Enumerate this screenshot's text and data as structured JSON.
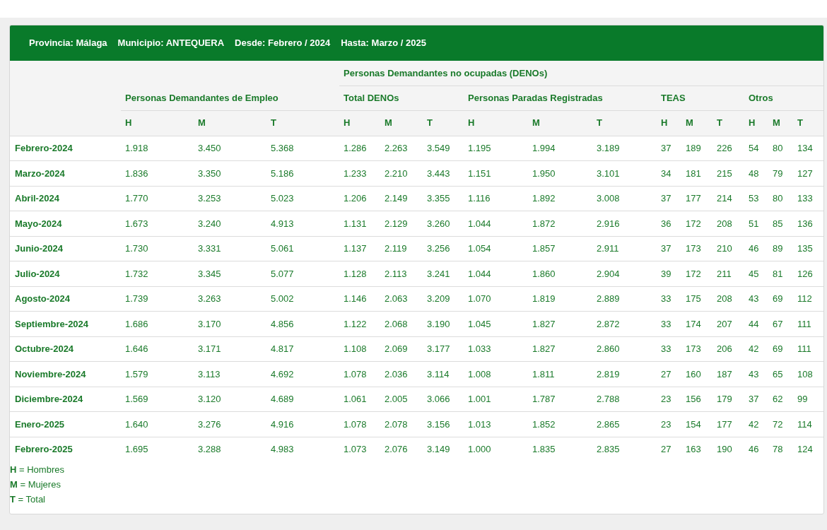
{
  "filter": [
    {
      "label": "Provincia:",
      "value": "Málaga"
    },
    {
      "label": "Municipio:",
      "value": "ANTEQUERA"
    },
    {
      "label": "Desde:",
      "value": "Febrero / 2024"
    },
    {
      "label": "Hasta:",
      "value": "Marzo / 2025"
    }
  ],
  "super_header": "Personas Demandantes no ocupadas (DENOs)",
  "groups": [
    "Personas Demandantes de Empleo",
    "Total DENOs",
    "Personas Paradas Registradas",
    "TEAS",
    "Otros"
  ],
  "subcolumns": [
    "H",
    "M",
    "T",
    "H",
    "M",
    "T",
    "H",
    "M",
    "T",
    "H",
    "M",
    "T",
    "H",
    "M",
    "T"
  ],
  "rows": [
    {
      "month": "Febrero-2024",
      "values": [
        "1.918",
        "3.450",
        "5.368",
        "1.286",
        "2.263",
        "3.549",
        "1.195",
        "1.994",
        "3.189",
        "37",
        "189",
        "226",
        "54",
        "80",
        "134"
      ]
    },
    {
      "month": "Marzo-2024",
      "values": [
        "1.836",
        "3.350",
        "5.186",
        "1.233",
        "2.210",
        "3.443",
        "1.151",
        "1.950",
        "3.101",
        "34",
        "181",
        "215",
        "48",
        "79",
        "127"
      ]
    },
    {
      "month": "Abril-2024",
      "values": [
        "1.770",
        "3.253",
        "5.023",
        "1.206",
        "2.149",
        "3.355",
        "1.116",
        "1.892",
        "3.008",
        "37",
        "177",
        "214",
        "53",
        "80",
        "133"
      ]
    },
    {
      "month": "Mayo-2024",
      "values": [
        "1.673",
        "3.240",
        "4.913",
        "1.131",
        "2.129",
        "3.260",
        "1.044",
        "1.872",
        "2.916",
        "36",
        "172",
        "208",
        "51",
        "85",
        "136"
      ]
    },
    {
      "month": "Junio-2024",
      "values": [
        "1.730",
        "3.331",
        "5.061",
        "1.137",
        "2.119",
        "3.256",
        "1.054",
        "1.857",
        "2.911",
        "37",
        "173",
        "210",
        "46",
        "89",
        "135"
      ]
    },
    {
      "month": "Julio-2024",
      "values": [
        "1.732",
        "3.345",
        "5.077",
        "1.128",
        "2.113",
        "3.241",
        "1.044",
        "1.860",
        "2.904",
        "39",
        "172",
        "211",
        "45",
        "81",
        "126"
      ]
    },
    {
      "month": "Agosto-2024",
      "values": [
        "1.739",
        "3.263",
        "5.002",
        "1.146",
        "2.063",
        "3.209",
        "1.070",
        "1.819",
        "2.889",
        "33",
        "175",
        "208",
        "43",
        "69",
        "112"
      ]
    },
    {
      "month": "Septiembre-2024",
      "values": [
        "1.686",
        "3.170",
        "4.856",
        "1.122",
        "2.068",
        "3.190",
        "1.045",
        "1.827",
        "2.872",
        "33",
        "174",
        "207",
        "44",
        "67",
        "111"
      ]
    },
    {
      "month": "Octubre-2024",
      "values": [
        "1.646",
        "3.171",
        "4.817",
        "1.108",
        "2.069",
        "3.177",
        "1.033",
        "1.827",
        "2.860",
        "33",
        "173",
        "206",
        "42",
        "69",
        "111"
      ]
    },
    {
      "month": "Noviembre-2024",
      "values": [
        "1.579",
        "3.113",
        "4.692",
        "1.078",
        "2.036",
        "3.114",
        "1.008",
        "1.811",
        "2.819",
        "27",
        "160",
        "187",
        "43",
        "65",
        "108"
      ]
    },
    {
      "month": "Diciembre-2024",
      "values": [
        "1.569",
        "3.120",
        "4.689",
        "1.061",
        "2.005",
        "3.066",
        "1.001",
        "1.787",
        "2.788",
        "23",
        "156",
        "179",
        "37",
        "62",
        "99"
      ]
    },
    {
      "month": "Enero-2025",
      "values": [
        "1.640",
        "3.276",
        "4.916",
        "1.078",
        "2.078",
        "3.156",
        "1.013",
        "1.852",
        "2.865",
        "23",
        "154",
        "177",
        "42",
        "72",
        "114"
      ]
    },
    {
      "month": "Febrero-2025",
      "values": [
        "1.695",
        "3.288",
        "4.983",
        "1.073",
        "2.076",
        "3.149",
        "1.000",
        "1.835",
        "2.835",
        "27",
        "163",
        "190",
        "46",
        "78",
        "124"
      ]
    }
  ],
  "legend": [
    "**H** = Hombres",
    "**M** = Mujeres",
    "**T** = Total"
  ]
}
